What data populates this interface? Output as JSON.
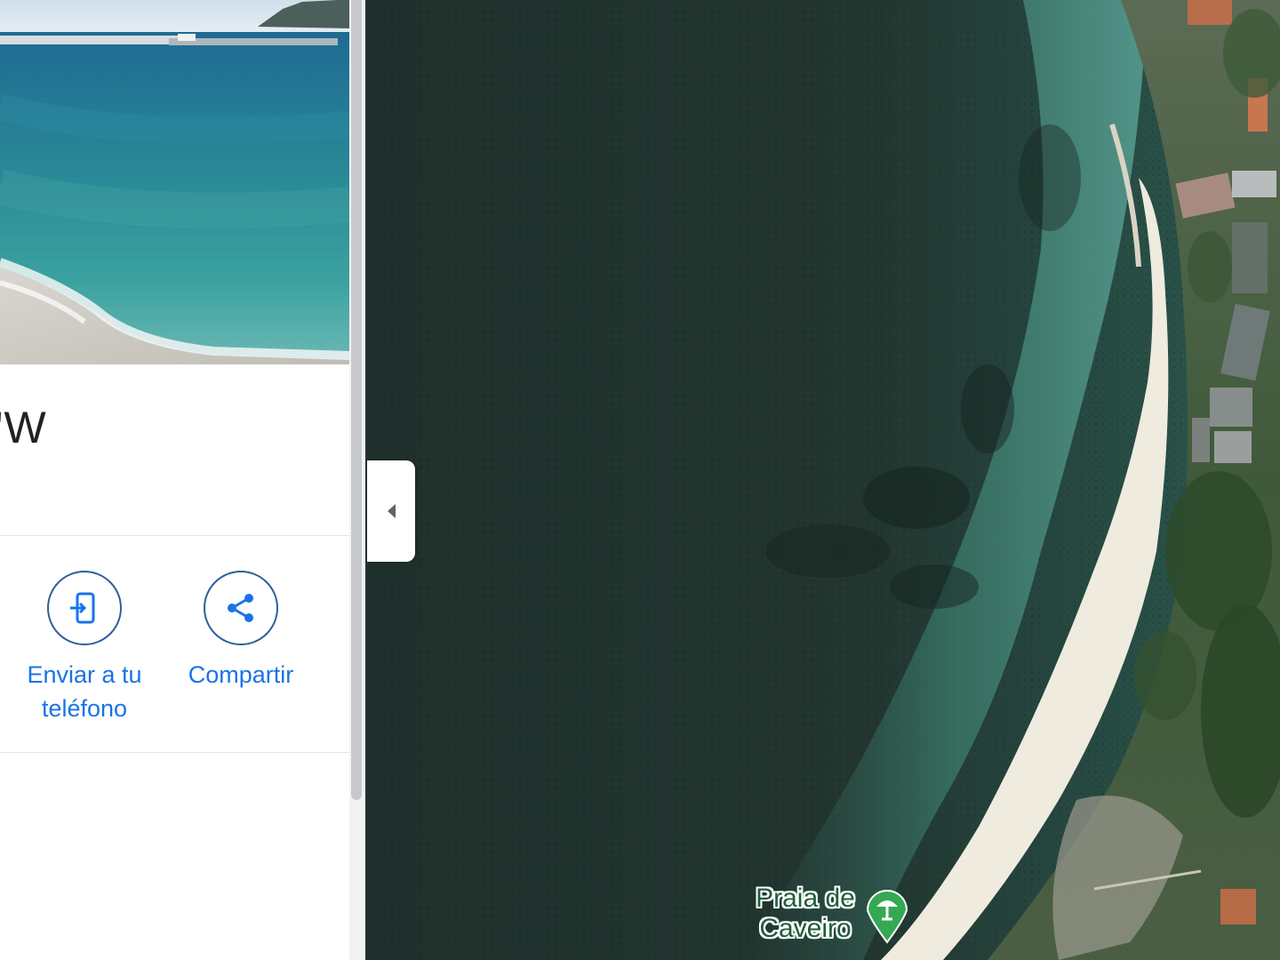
{
  "panel": {
    "coordinates_title": "'W",
    "actions": [
      {
        "label": "Enviar a tu teléfono",
        "icon": "send-to-phone-icon"
      },
      {
        "label": "Compartir",
        "icon": "share-icon"
      }
    ]
  },
  "map": {
    "place_label": "Praia de Caveiro",
    "place_icon": "beach-umbrella-pin-icon"
  },
  "colors": {
    "accent": "#1a73e8",
    "action_border": "#2f5f9a",
    "pin_green": "#34a853",
    "label_green": "#1e5e3a"
  }
}
